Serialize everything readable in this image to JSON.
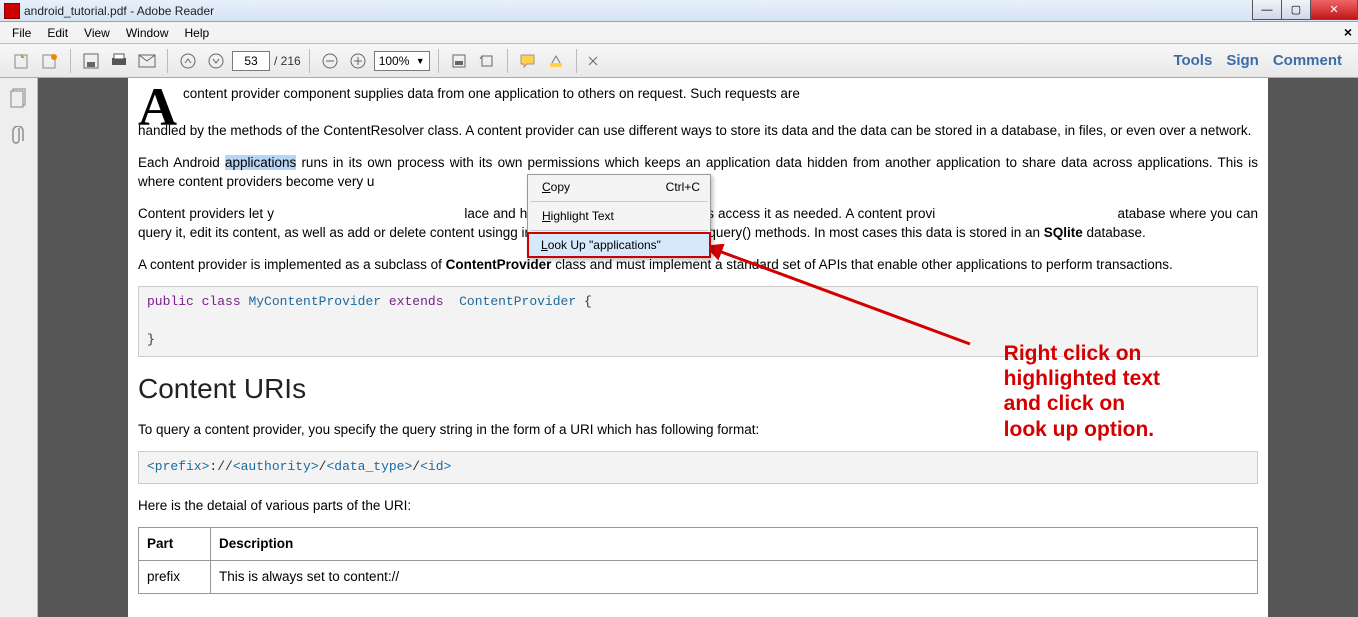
{
  "window": {
    "title": "android_tutorial.pdf - Adobe Reader"
  },
  "menu": {
    "file": "File",
    "edit": "Edit",
    "view": "View",
    "window": "Window",
    "help": "Help"
  },
  "toolbar": {
    "page_current": "53",
    "page_total": "/ 216",
    "zoom": "100%",
    "right": {
      "tools": "Tools",
      "sign": "Sign",
      "comment": "Comment"
    }
  },
  "context_menu": {
    "copy": "Copy",
    "copy_shortcut": "Ctrl+C",
    "highlight": "Highlight Text",
    "lookup": "Look Up \"applications\""
  },
  "annotation": {
    "text": "Right click on highlighted text and click on look up option."
  },
  "doc": {
    "drop": "A",
    "p1_a": "content provider component supplies data from one application to others on request. Such requests are",
    "p1_b": "handled by the methods of the ContentResolver class. A content provider can use different ways to store its data and the data can be stored in a database, in files, or even over a network.",
    "p2_pre": "Each Android ",
    "p2_hl": "applications",
    "p2_mid": " runs in its own process with its own permissions which keeps an application data hidden from another application",
    "p2_after": " to share data across applications. This is where content providers become very u",
    "p3": "Content providers let y                                               lace and have many different applications access it as needed. A content provi                                             atabase where you can query it, edit its content, as well as add or delete content usingg insert(), update(), delete(), and query() methods. In most cases this data is stored in an ",
    "p3_b": "SQlite",
    "p3_c": " database.",
    "p4_a": "A content provider is implemented as a subclass of ",
    "p4_b": "ContentProvider",
    "p4_c": " class and must implement a standard set of APIs that enable other applications to perform transactions.",
    "code1": "public class MyContentProvider extends  ContentProvider {\n\n}",
    "h2": "Content URIs",
    "p5": "To query a content provider, you specify the query string in the form of a URI which has following format:",
    "code2": "<prefix>://<authority>/<data_type>/<id>",
    "p6": "Here is the detaial of various parts of the URI:",
    "table": {
      "h1": "Part",
      "h2": "Description",
      "r1c1": "prefix",
      "r1c2": "This is always set to content://"
    }
  }
}
